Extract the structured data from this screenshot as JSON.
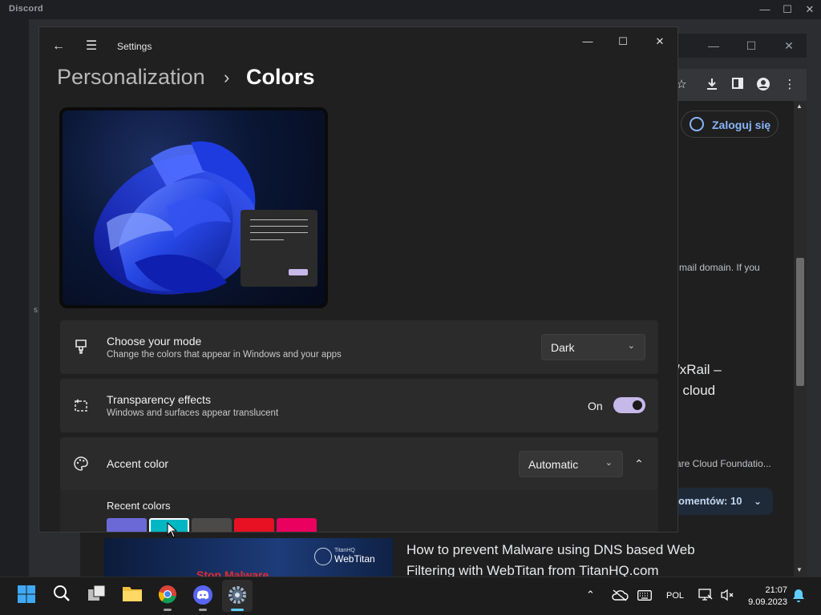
{
  "discord": {
    "title": "Discord",
    "controls": {
      "minimize": "—",
      "maximize": "☐",
      "close": "✕"
    }
  },
  "chrome": {
    "controls": {
      "minimize": "—",
      "maximize": "☐",
      "close": "✕"
    },
    "login_button": "Zaloguj się",
    "snippet_small_1": "mail domain. If you",
    "snippet_big_1": "/xRail –",
    "snippet_big_2": "l cloud",
    "snippet_small_2": "are Cloud Foundatio...",
    "comments_button": "omentów: 10",
    "video_title": "How to prevent Malware using DNS based Web Filtering with WebTitan from TitanHQ.com",
    "thumb_brand_small": "TitanHQ",
    "thumb_brand": "WebTitan",
    "thumb_red_text": "Stop Malware",
    "left_edge_letter": "s"
  },
  "settings": {
    "window_title": "Settings",
    "controls": {
      "minimize": "—",
      "maximize": "☐",
      "close": "✕"
    },
    "breadcrumb": {
      "parent": "Personalization",
      "separator": "›",
      "current": "Colors"
    },
    "mode": {
      "title": "Choose your mode",
      "description": "Change the colors that appear in Windows and your apps",
      "value": "Dark"
    },
    "transparency": {
      "title": "Transparency effects",
      "description": "Windows and surfaces appear translucent",
      "state_label": "On"
    },
    "accent": {
      "title": "Accent color",
      "value": "Automatic",
      "recent_label": "Recent colors",
      "recent_colors": [
        "#6b69d6",
        "#00b7c3",
        "#4c4a48",
        "#e81123",
        "#ea005e"
      ]
    }
  },
  "taskbar": {
    "language": "POL",
    "time": "21:07",
    "date": "9.09.2023"
  }
}
